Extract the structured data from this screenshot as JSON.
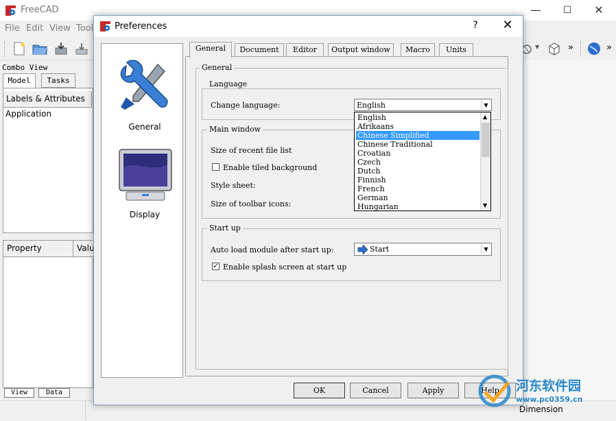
{
  "main_window": {
    "title": "FreeCAD",
    "minimize_glyph": "—",
    "maximize_glyph": "☐",
    "close_glyph": "✕",
    "menu": [
      "File",
      "Edit",
      "View",
      "Tool"
    ],
    "combo_view_title": "Combo View",
    "combo_tabs": [
      "Model",
      "Tasks"
    ],
    "tree_header": "Labels & Attributes",
    "tree_item": "Application",
    "property_columns": [
      "Property",
      "Valu"
    ],
    "bottom_tabs": [
      "View",
      "Data"
    ],
    "toolbar_overflow": "»",
    "status_dimension": "Dimension"
  },
  "dialog": {
    "title": "Preferences",
    "help_glyph": "?",
    "close_glyph": "✕",
    "categories": [
      {
        "label": "General",
        "icon": "tools-icon"
      },
      {
        "label": "Display",
        "icon": "monitor-icon"
      }
    ],
    "tabs": [
      "General",
      "Document",
      "Editor",
      "Output window",
      "Macro",
      "Units"
    ],
    "active_tab": "General",
    "general_group_title": "General",
    "language_group": {
      "title": "Language",
      "label": "Change language:",
      "value": "English",
      "options": [
        "English",
        "Afrikaans",
        "Chinese Simplified",
        "Chinese Traditional",
        "Croatian",
        "Czech",
        "Dutch",
        "Finnish",
        "French",
        "German",
        "Hungarian"
      ],
      "highlighted": "Chinese Simplified"
    },
    "main_window_group": {
      "title": "Main window",
      "recent_files_label": "Size of recent file list",
      "tiled_background_label": "Enable tiled background",
      "tiled_background_checked": false,
      "style_sheet_label": "Style sheet:",
      "toolbar_icons_label": "Size of toolbar icons:"
    },
    "startup_group": {
      "title": "Start up",
      "autoload_label": "Auto load module after start up:",
      "autoload_value": "Start",
      "splash_label": "Enable splash screen at start up",
      "splash_checked": true
    },
    "buttons": {
      "ok": "OK",
      "cancel": "Cancel",
      "apply": "Apply",
      "help": "Help"
    }
  },
  "watermark": {
    "name": "河东软件园",
    "url": "www.pc0359.cn"
  },
  "colors": {
    "selection": "#3399ff",
    "accent_blue": "#2a88c8"
  }
}
